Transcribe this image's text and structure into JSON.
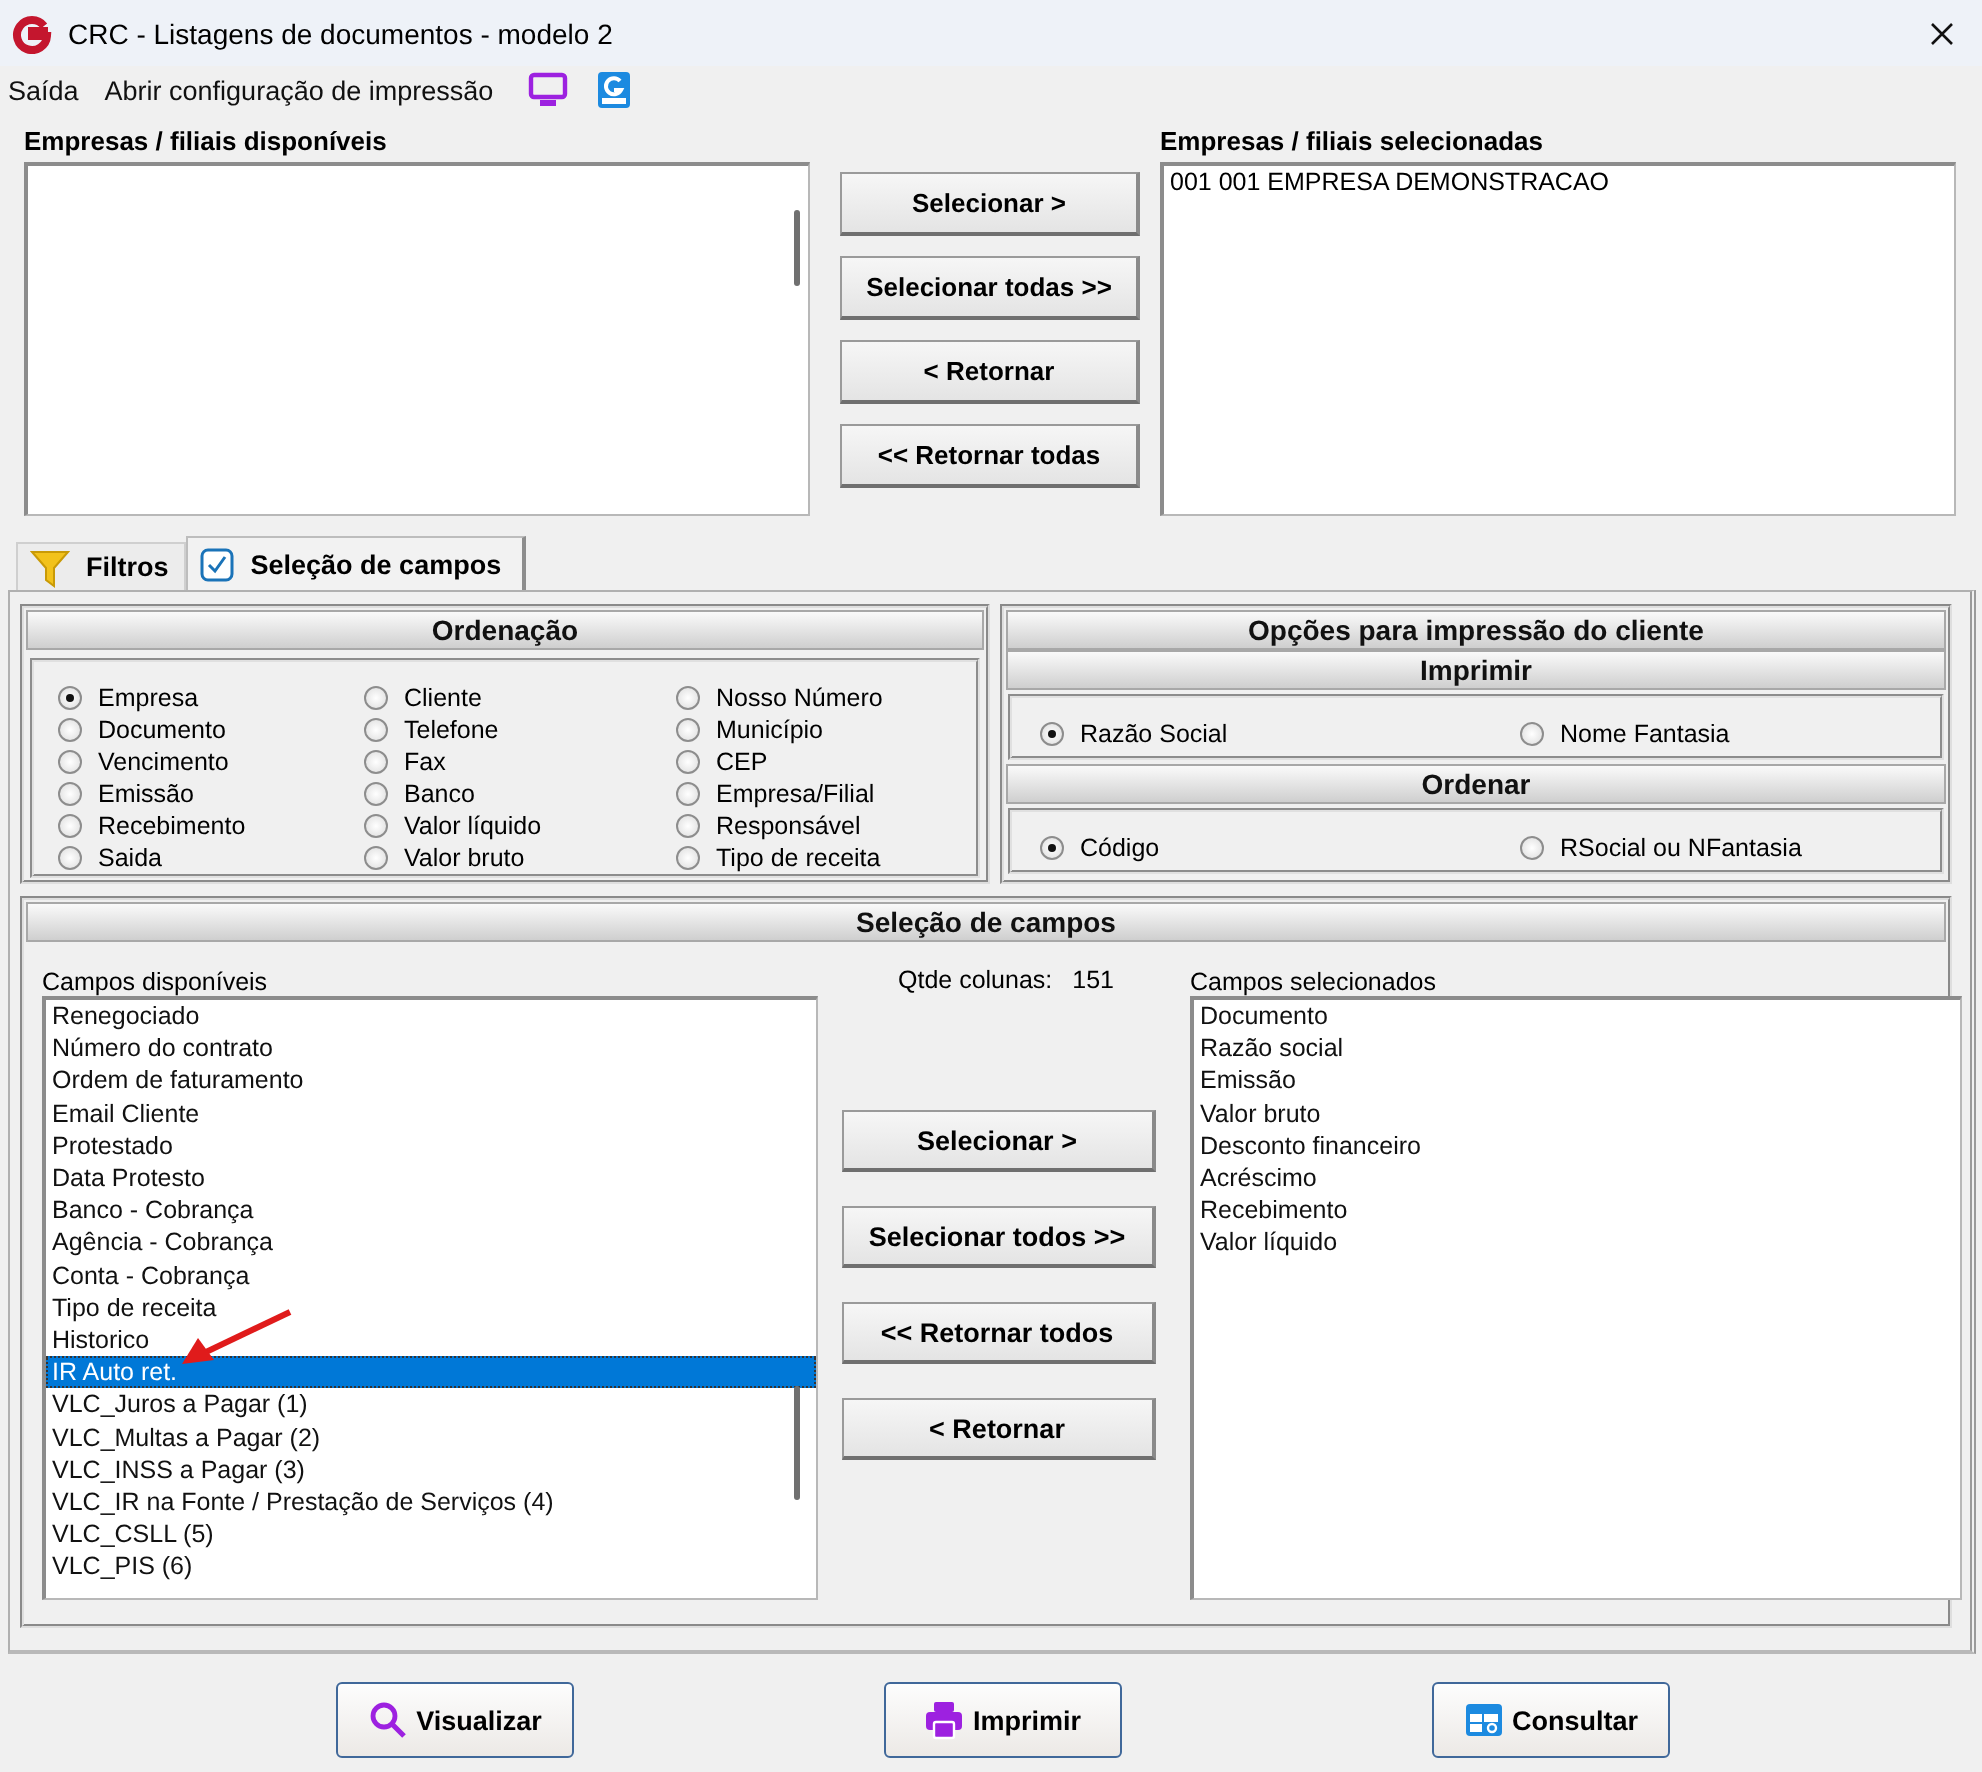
{
  "window": {
    "title": "CRC - Listagens de documentos - modelo 2"
  },
  "menu": [
    {
      "label": "Saída"
    },
    {
      "label": "Abrir configuração de impressão"
    }
  ],
  "companies": {
    "available": {
      "label": "Empresas / filiais disponíveis"
    },
    "buttons": [
      "Selecionar >",
      "Selecionar todas >>",
      "< Retornar",
      "<< Retornar todas"
    ],
    "selected": {
      "label": "Empresas / filiais selecionadas",
      "items": [
        "001 001 EMPRESA DEMONSTRACAO"
      ]
    }
  },
  "tabs": [
    {
      "label": "Filtros",
      "selected": false
    },
    {
      "label": "Seleção de campos",
      "selected": true
    }
  ],
  "ordering": {
    "title": "Ordenação",
    "options": [
      {
        "label": "Empresa",
        "selected": true
      },
      {
        "label": "Documento",
        "selected": false
      },
      {
        "label": "Vencimento",
        "selected": false
      },
      {
        "label": "Emissão",
        "selected": false
      },
      {
        "label": "Recebimento",
        "selected": false
      },
      {
        "label": "Saida",
        "selected": false
      },
      {
        "label": "Cliente",
        "selected": false
      },
      {
        "label": "Telefone",
        "selected": false
      },
      {
        "label": "Fax",
        "selected": false
      },
      {
        "label": "Banco",
        "selected": false
      },
      {
        "label": "Valor líquido",
        "selected": false
      },
      {
        "label": "Valor bruto",
        "selected": false
      },
      {
        "label": "Nosso Número",
        "selected": false
      },
      {
        "label": "Município",
        "selected": false
      },
      {
        "label": "CEP",
        "selected": false
      },
      {
        "label": "Empresa/Filial",
        "selected": false
      },
      {
        "label": "Responsável",
        "selected": false
      },
      {
        "label": "Tipo de receita",
        "selected": false
      }
    ]
  },
  "print_options": {
    "title": "Opções para impressão do cliente",
    "groups": [
      {
        "title": "Imprimir",
        "options": [
          {
            "label": "Razão Social",
            "selected": true
          },
          {
            "label": "Nome Fantasia",
            "selected": false
          }
        ]
      },
      {
        "title": "Ordenar",
        "options": [
          {
            "label": "Código",
            "selected": true
          },
          {
            "label": "RSocial ou NFantasia",
            "selected": false
          }
        ]
      }
    ]
  },
  "field_selection": {
    "title": "Seleção de campos",
    "available": {
      "label": "Campos disponíveis",
      "items": [
        {
          "label": "Renegociado",
          "selected": false
        },
        {
          "label": "Número do contrato",
          "selected": false
        },
        {
          "label": "Ordem de faturamento",
          "selected": false
        },
        {
          "label": "Email Cliente",
          "selected": false
        },
        {
          "label": "Protestado",
          "selected": false
        },
        {
          "label": "Data Protesto",
          "selected": false
        },
        {
          "label": "Banco - Cobrança",
          "selected": false
        },
        {
          "label": "Agência - Cobrança",
          "selected": false
        },
        {
          "label": "Conta - Cobrança",
          "selected": false
        },
        {
          "label": "Tipo de receita",
          "selected": false
        },
        {
          "label": "Historico",
          "selected": false
        },
        {
          "label": "IR Auto ret.",
          "selected": true
        },
        {
          "label": "VLC_Juros a Pagar (1)",
          "selected": false
        },
        {
          "label": "VLC_Multas a Pagar (2)",
          "selected": false
        },
        {
          "label": "VLC_INSS a Pagar (3)",
          "selected": false
        },
        {
          "label": "VLC_IR na Fonte / Prestação de Serviços (4)",
          "selected": false
        },
        {
          "label": "VLC_CSLL (5)",
          "selected": false
        },
        {
          "label": "VLC_PIS (6)",
          "selected": false
        }
      ]
    },
    "count_label": "Qtde colunas:",
    "count": "151",
    "buttons": [
      "Selecionar >",
      "Selecionar todos >>",
      "<< Retornar todos",
      "< Retornar"
    ],
    "selected": {
      "label": "Campos selecionados",
      "items": [
        "Documento",
        "Razão social",
        "Emissão",
        "Valor bruto",
        "Desconto financeiro",
        "Acréscimo",
        "Recebimento",
        "Valor líquido"
      ]
    }
  },
  "footer_buttons": [
    {
      "label": "Visualizar"
    },
    {
      "label": "Imprimir"
    },
    {
      "label": "Consultar"
    }
  ]
}
